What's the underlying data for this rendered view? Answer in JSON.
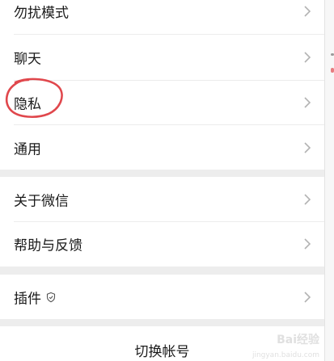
{
  "settings": {
    "items": [
      {
        "label": "勿扰模式"
      },
      {
        "label": "聊天"
      },
      {
        "label": "隐私"
      },
      {
        "label": "通用"
      },
      {
        "label": "关于微信"
      },
      {
        "label": "帮助与反馈"
      },
      {
        "label": "插件"
      }
    ],
    "switch_account_label": "切换帐号"
  },
  "icons": {
    "row_chevron": "chevron-right-icon",
    "plugin_badge": "shield-icon"
  },
  "colors": {
    "background": "#ededed",
    "cell": "#ffffff",
    "text": "#1a1a1a",
    "chevron": "#b2b2b2",
    "highlight_circle": "#e0474c"
  },
  "watermark": {
    "text": "Bai经验",
    "sub": "jingyan.baidu.com"
  }
}
